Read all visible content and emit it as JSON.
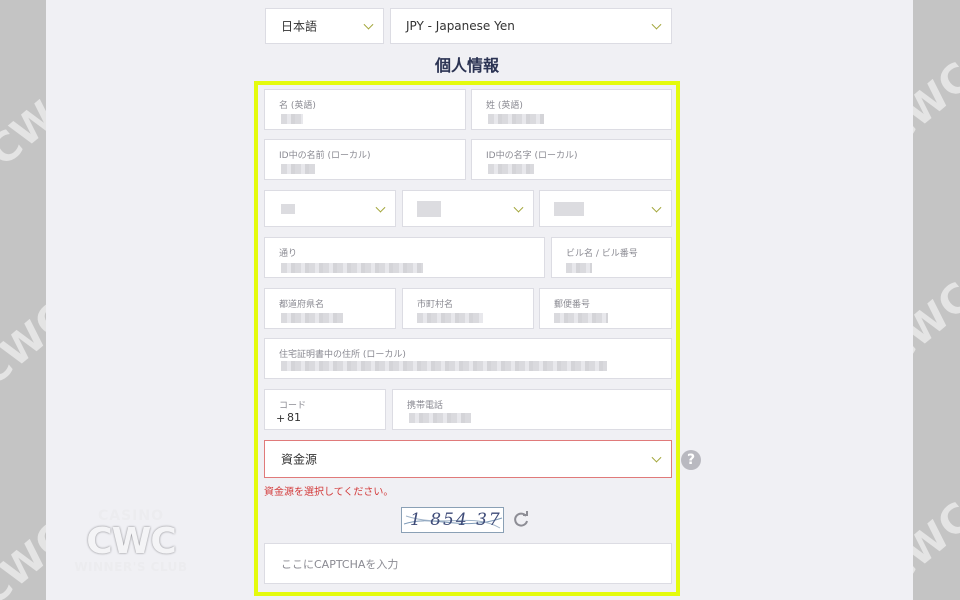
{
  "language_select": {
    "value": "日本語"
  },
  "currency_select": {
    "value": "JPY - Japanese Yen"
  },
  "section_title": "個人情報",
  "fields": {
    "first_name_en": "名 (英語)",
    "last_name_en": "姓 (英語)",
    "first_name_local": "ID中の名前 (ローカル)",
    "last_name_local": "ID中の名字 (ローカル)",
    "street": "通り",
    "building": "ビル名 / ビル番号",
    "prefecture": "都道府県名",
    "city": "市町村名",
    "postal_code": "郵便番号",
    "id_address": "住宅証明書中の住所 (ローカル)",
    "code": "コード",
    "mobile": "携帯電話"
  },
  "phone_code": {
    "plus": "+",
    "value": "81"
  },
  "source_of_funds": {
    "value": "資金源",
    "error": "資金源を選択してください。"
  },
  "help_icon": "?",
  "captcha": {
    "image_text": "1 854 37",
    "placeholder": "ここにCAPTCHAを入力"
  },
  "logo": {
    "top": "CASINO",
    "main": "CWC",
    "bottom": "WINNER'S CLUB"
  },
  "watermark": {
    "text": "CWC WINNER'S CLUB CASINO"
  },
  "colors": {
    "frame": "#e4fb0c",
    "error": "#d33b3b",
    "title": "#2b3353"
  }
}
